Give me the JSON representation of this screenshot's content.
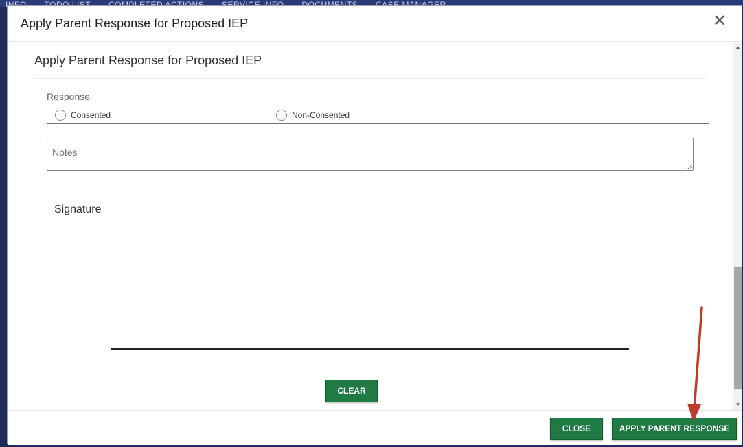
{
  "backdrop": {
    "tabs": [
      "INFO",
      "TODO LIST",
      "COMPLETED ACTIONS",
      "SERVICE INFO",
      "DOCUMENTS",
      "CASE MANAGER"
    ]
  },
  "modal": {
    "title": "Apply Parent Response for Proposed IEP",
    "close_glyph": "✕"
  },
  "form": {
    "section_title": "Apply Parent Response for Proposed IEP",
    "response_label": "Response",
    "options": [
      {
        "label": "Consented",
        "selected": false
      },
      {
        "label": "Non-Consented",
        "selected": false
      }
    ],
    "notes_placeholder": "Notes",
    "signature_title": "Signature",
    "clear_label": "CLEAR"
  },
  "footer": {
    "close_label": "CLOSE",
    "apply_label": "APPLY PARENT RESPONSE"
  },
  "colors": {
    "button_green": "#1f7a44",
    "annotation_arrow": "#c0392b"
  }
}
